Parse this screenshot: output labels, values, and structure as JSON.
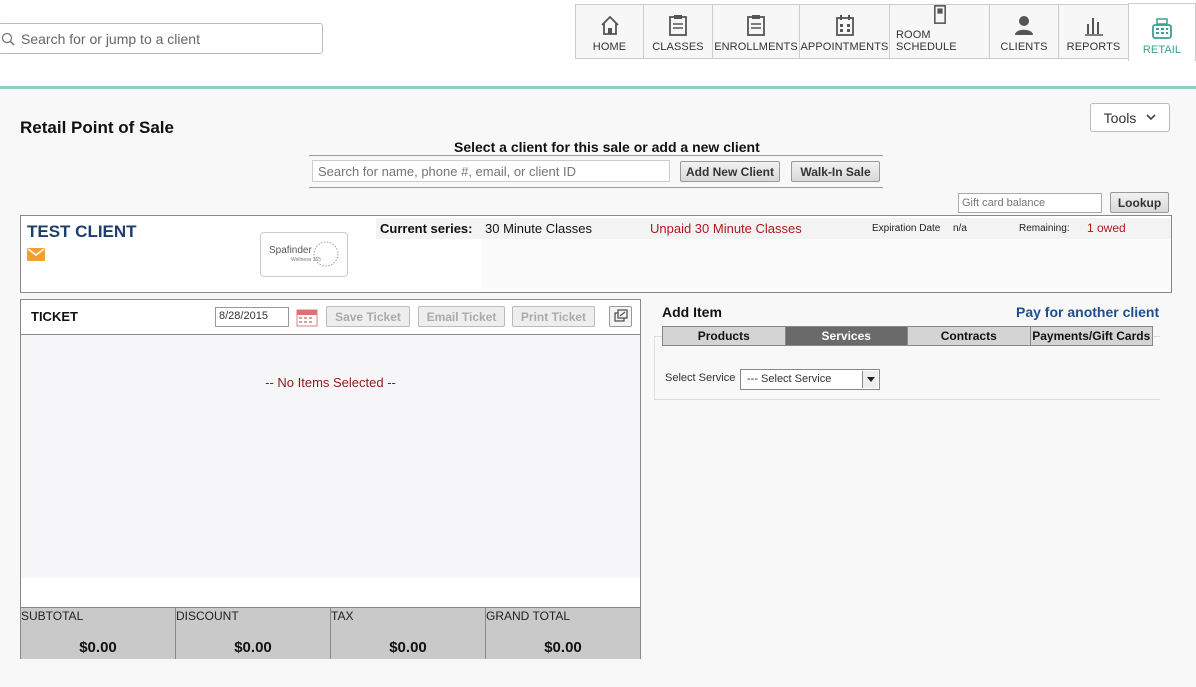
{
  "search": {
    "placeholder": "Search for or jump to a client"
  },
  "nav": {
    "items": [
      {
        "label": "HOME",
        "icon": "home-icon"
      },
      {
        "label": "CLASSES",
        "icon": "clipboard-icon"
      },
      {
        "label": "ENROLLMENTS",
        "icon": "clipboard-icon"
      },
      {
        "label": "APPOINTMENTS",
        "icon": "calendar-icon"
      },
      {
        "label": "ROOM SCHEDULE",
        "icon": "door-icon"
      },
      {
        "label": "CLIENTS",
        "icon": "person-icon"
      },
      {
        "label": "REPORTS",
        "icon": "bar-chart-icon"
      },
      {
        "label": "RETAIL",
        "icon": "register-icon",
        "active": true
      }
    ],
    "active_color": "#3aa091"
  },
  "tools": {
    "label": "Tools"
  },
  "page": {
    "title": "Retail Point of Sale"
  },
  "client_select": {
    "prompt": "Select a client for this sale or add a new client",
    "placeholder": "Search for name, phone #, email, or client ID",
    "add_new_label": "Add New Client",
    "walk_in_label": "Walk-In Sale"
  },
  "gift_card": {
    "placeholder": "Gift card balance",
    "lookup_label": "Lookup"
  },
  "client": {
    "name": "TEST CLIENT",
    "logo_text": "Spafinder",
    "logo_subtext": "Wellness 365",
    "series_label": "Current series:",
    "series_value": "30 Minute Classes",
    "unpaid_text": "Unpaid 30 Minute Classes",
    "expiration_label": "Expiration Date",
    "expiration_value": "n/a",
    "remaining_label": "Remaining:",
    "remaining_value": "1 owed"
  },
  "ticket": {
    "title": "TICKET",
    "date": "8/28/2015",
    "save_label": "Save Ticket",
    "email_label": "Email Ticket",
    "print_label": "Print Ticket",
    "empty_text": "-- No Items Selected --",
    "totals": [
      {
        "label": "SUBTOTAL",
        "value": "$0.00"
      },
      {
        "label": "DISCOUNT",
        "value": "$0.00"
      },
      {
        "label": "TAX",
        "value": "$0.00"
      },
      {
        "label": "GRAND TOTAL",
        "value": "$0.00"
      }
    ]
  },
  "add_item": {
    "title": "Add Item",
    "pay_other_label": "Pay for another client",
    "tabs": [
      "Products",
      "Services",
      "Contracts",
      "Payments/Gift Cards"
    ],
    "active_tab": "Services",
    "service_label": "Select Service",
    "service_value": "--- Select Service"
  },
  "colors": {
    "client_name": "#1c3f6e",
    "link": "#1c4f8c",
    "alert": "#b0191e",
    "accent_bar": "#8ecfc2"
  }
}
